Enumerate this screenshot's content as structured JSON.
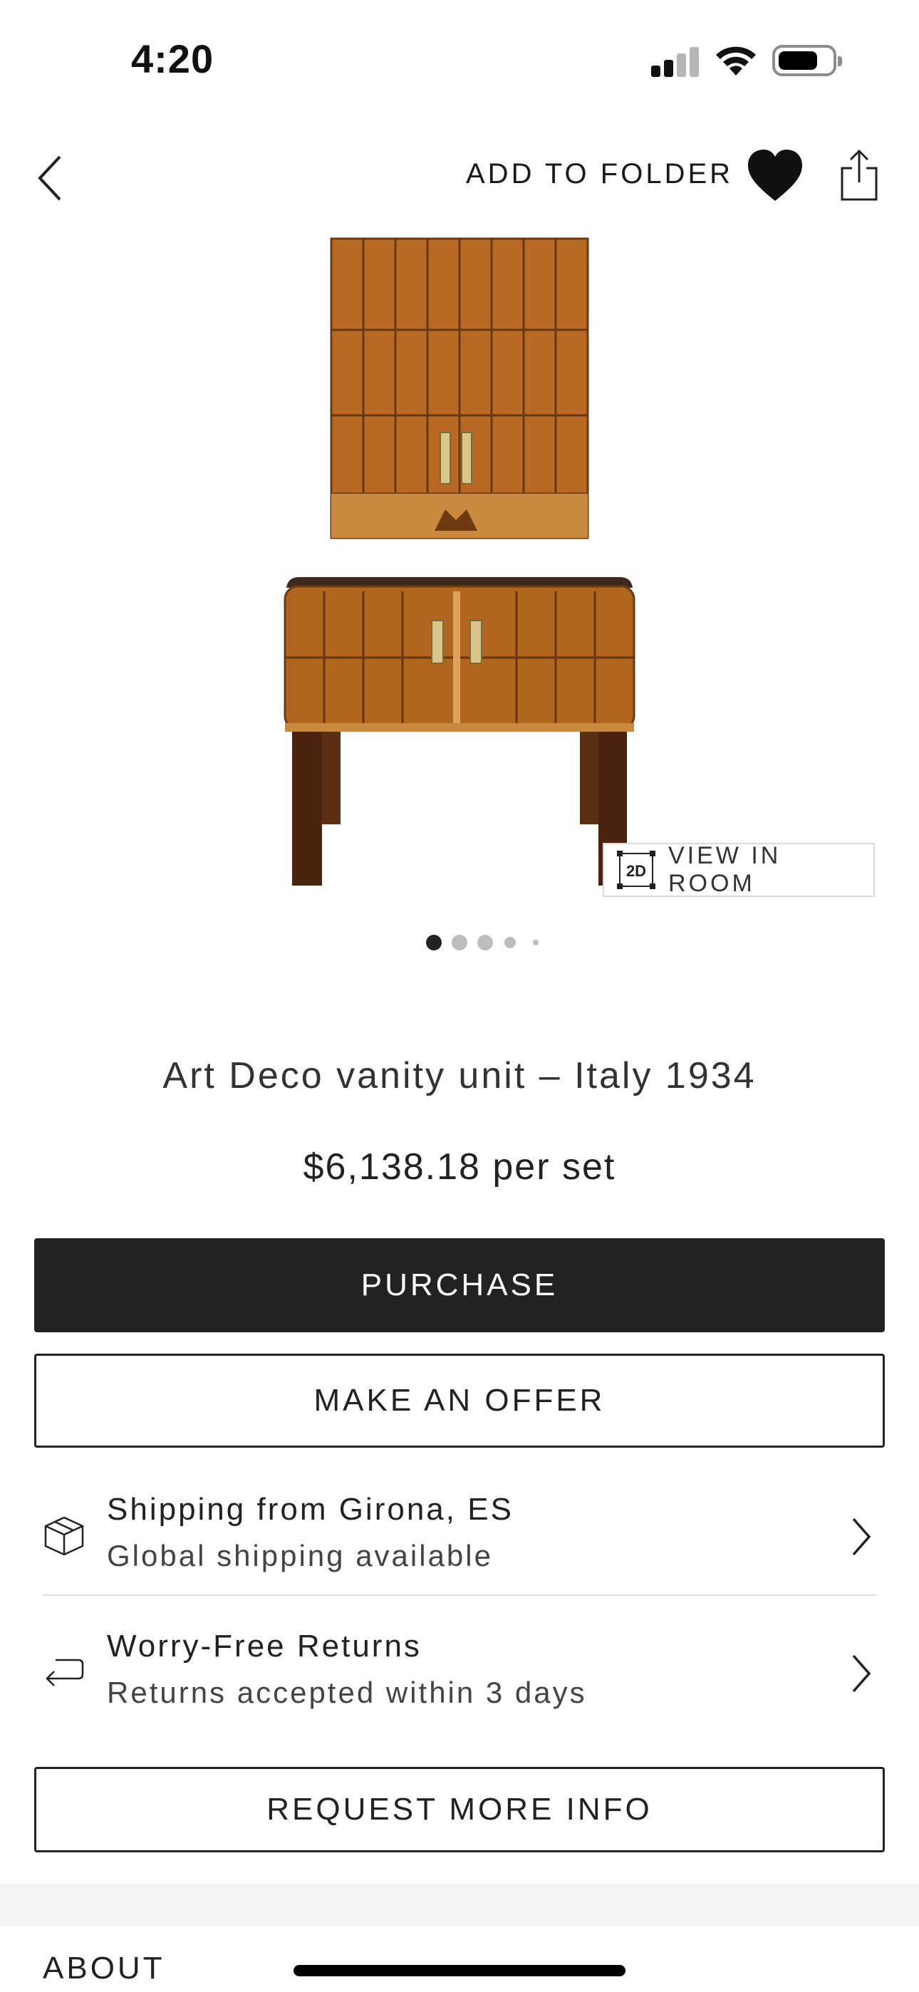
{
  "status_bar": {
    "time": "4:20"
  },
  "nav": {
    "add_to_folder_label": "ADD TO FOLDER"
  },
  "gallery": {
    "view_in_room_badge": "2D",
    "view_in_room_label": "VIEW IN ROOM",
    "image_count": 5,
    "active_index": 0
  },
  "product": {
    "title": "Art Deco vanity unit – Italy 1934",
    "price": "$6,138.18 per set"
  },
  "actions": {
    "purchase_label": "PURCHASE",
    "offer_label": "MAKE AN OFFER",
    "request_info_label": "REQUEST MORE INFO"
  },
  "info_rows": {
    "shipping": {
      "title": "Shipping from Girona, ES",
      "subtitle": "Global shipping available"
    },
    "returns": {
      "title": "Worry-Free Returns",
      "subtitle": "Returns accepted within 3 days"
    }
  },
  "sections": {
    "about_heading": "ABOUT"
  },
  "colors": {
    "primary_button": "#222222",
    "text": "#222222",
    "wood": "#b86a24"
  }
}
